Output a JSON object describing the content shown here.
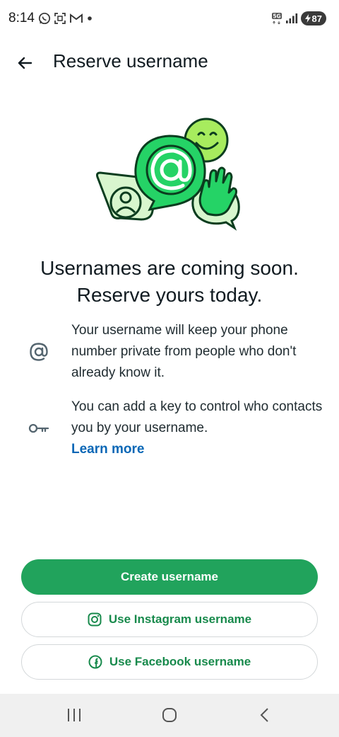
{
  "status_bar": {
    "time": "8:14",
    "network": "5G",
    "battery": "87"
  },
  "app_bar": {
    "title": "Reserve username"
  },
  "headline": {
    "line1": "Usernames are coming soon.",
    "line2": "Reserve yours today."
  },
  "info": [
    {
      "icon": "at-sign-icon",
      "text": "Your username will keep your phone number private from people who don't already know it."
    },
    {
      "icon": "key-icon",
      "text": "You can add a key to control who contacts you by your username.",
      "link": "Learn more"
    }
  ],
  "buttons": {
    "create": "Create username",
    "instagram": "Use Instagram username",
    "facebook": "Use Facebook username"
  },
  "colors": {
    "primary_green": "#21a35c",
    "link_blue": "#0a67b6",
    "outline_text_green": "#188a4c"
  }
}
